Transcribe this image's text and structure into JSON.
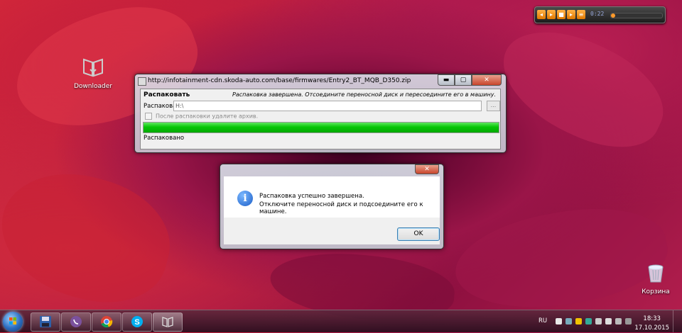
{
  "desktop": {
    "icons": [
      {
        "label": "Downloader"
      },
      {
        "label": "Корзина"
      }
    ]
  },
  "gadget": {
    "time": "0:22",
    "progress": 0.08
  },
  "main_window": {
    "title": "http://infotainment-cdn.skoda-auto.com/base/firmwares/Entry2_BT_MQB_D350.zip",
    "header_left": "Распаковать",
    "header_right": "Распаковка завершена. Отсоедините переносной диск и пересоедините его в машину.",
    "extract_label": "Распаковать",
    "path_value": "H:\\",
    "browse_label": "...",
    "delete_after_label": "После распаковки удалите архив.",
    "progress": 1.0,
    "status": "Распаковано"
  },
  "dialog": {
    "message_line1": "Распаковка успешно завершена.",
    "message_line2": "Отключите переносной диск и подсоедините его к машине.",
    "ok_label": "OK"
  },
  "taskbar": {
    "language": "RU",
    "time": "18:33",
    "date": "17.10.2015"
  },
  "colors": {
    "progress_green": "#06c606",
    "close_red": "#c8452c",
    "info_blue": "#1d5fc8"
  }
}
